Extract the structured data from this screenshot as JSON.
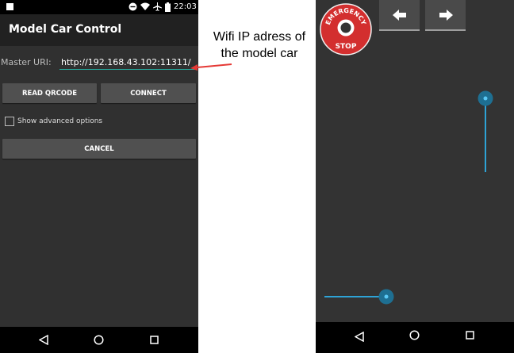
{
  "left_phone": {
    "status_time": "22:03",
    "app_title": "Model Car Control",
    "master_uri_label": "Master URI:",
    "master_uri_value": "http://192.168.43.102:11311/",
    "read_qr_label": "READ QRCODE",
    "connect_label": "CONNECT",
    "show_advanced_label": "Show advanced options",
    "show_advanced_checked": false,
    "cancel_label": "CANCEL"
  },
  "annotation": {
    "line1": "Wifi IP adress of",
    "line2": "the model car",
    "arrow_color": "#e53935"
  },
  "right_phone": {
    "emergency_top_text": "EMERGENCY",
    "emergency_bottom_text": "STOP",
    "left_arrow_icon": "arrow-left-icon",
    "right_arrow_icon": "arrow-right-icon",
    "slider_color": "#2ea3d6"
  },
  "colors": {
    "background_dark": "#303030",
    "accent_teal": "#26a69a",
    "emergency_red": "#d32f2f"
  }
}
